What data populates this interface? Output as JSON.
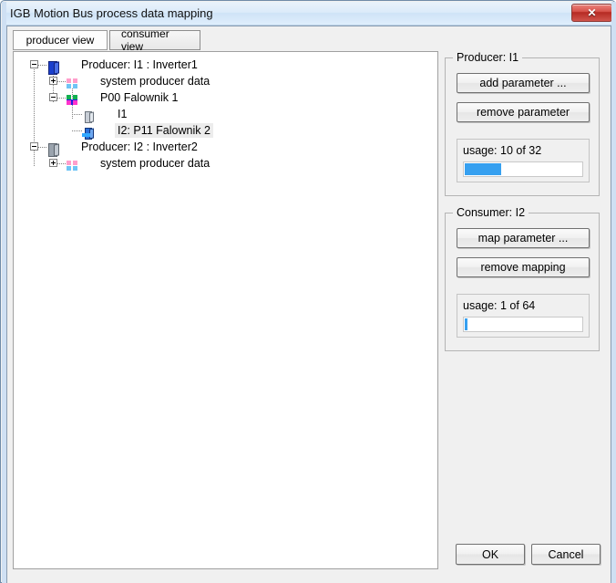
{
  "window": {
    "title": "IGB Motion Bus process data mapping",
    "close_label": "✕"
  },
  "tabs": [
    {
      "label": "producer view",
      "active": true
    },
    {
      "label": "consumer view",
      "active": false
    }
  ],
  "tree": {
    "nodes": [
      {
        "label": "Producer: I1 : Inverter1",
        "icon": "inverter-icon",
        "expander": "minus",
        "depth": 0,
        "selected": false
      },
      {
        "label": "system producer data",
        "icon": "producer-data-icon",
        "expander": "plus",
        "depth": 1,
        "selected": false
      },
      {
        "label": "P00 Falownik 1",
        "icon": "parameter-group-icon",
        "expander": "minus",
        "depth": 1,
        "selected": false
      },
      {
        "label": "I1",
        "icon": "parameter-icon",
        "expander": "none",
        "depth": 2,
        "selected": false
      },
      {
        "label": "I2: P11 Falownik 2",
        "icon": "mapped-parameter-icon",
        "expander": "none",
        "depth": 2,
        "selected": true
      },
      {
        "label": "Producer: I2 : Inverter2",
        "icon": "inverter-grey-icon",
        "expander": "minus",
        "depth": 0,
        "selected": false
      },
      {
        "label": "system producer data",
        "icon": "producer-data-icon",
        "expander": "plus",
        "depth": 1,
        "selected": false
      }
    ]
  },
  "producer_group": {
    "title": "Producer: I1",
    "add_parameter_label": "add parameter ...",
    "remove_parameter_label": "remove parameter",
    "usage_label": "usage: 10 of 32",
    "usage_used": 10,
    "usage_total": 32,
    "usage_percent": 31,
    "bar_color": "#36a0f0"
  },
  "consumer_group": {
    "title": "Consumer: I2",
    "map_parameter_label": "map parameter ...",
    "remove_mapping_label": "remove mapping",
    "usage_label": "usage: 1 of 64",
    "usage_used": 1,
    "usage_total": 64,
    "usage_percent": 2,
    "bar_color": "#36a0f0"
  },
  "footer": {
    "ok_label": "OK",
    "cancel_label": "Cancel"
  }
}
